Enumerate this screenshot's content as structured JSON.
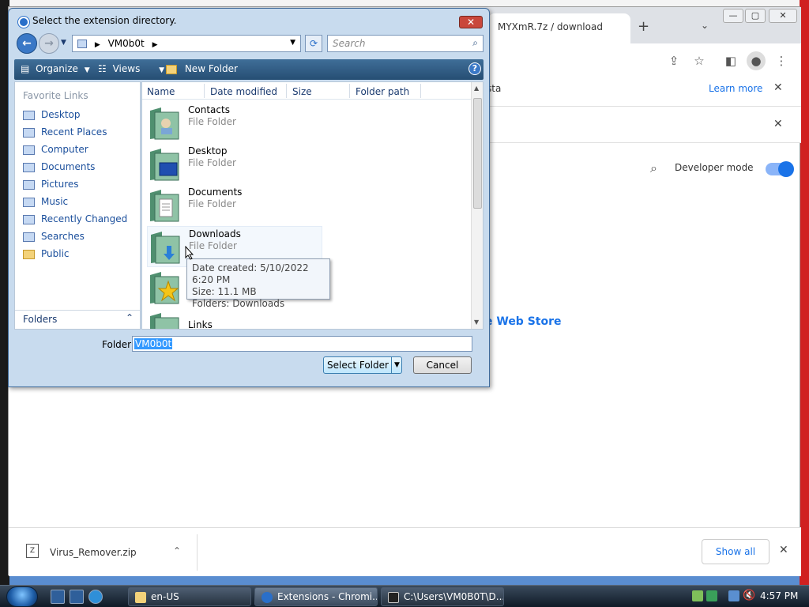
{
  "browser": {
    "tabs": [
      {
        "label": "MYXmR.7z / download"
      }
    ],
    "new_tab_label": "+",
    "banners": [
      {
        "text": "sta",
        "action": "Learn more",
        "close": "✕"
      },
      {
        "text": "",
        "close": "✕"
      }
    ],
    "developer_mode_label": "Developer mode",
    "developer_mode_on": true,
    "web_store_link": "e Web Store",
    "accent_color": "#1a73e8"
  },
  "downloads": {
    "items": [
      {
        "filename": "Virus_Remover.zip"
      }
    ],
    "show_all_label": "Show all",
    "close": "✕"
  },
  "dialog": {
    "title": "Select the extension directory.",
    "path_segment": "VM0b0t",
    "search_placeholder": "Search",
    "commands": {
      "organize": "Organize",
      "views": "Views",
      "new_folder": "New Folder",
      "help": "?"
    },
    "favorite_links_header": "Favorite Links",
    "favorite_links": [
      "Desktop",
      "Recent Places",
      "Computer",
      "Documents",
      "Pictures",
      "Music",
      "Recently Changed",
      "Searches",
      "Public"
    ],
    "folders_label": "Folders",
    "columns": [
      "Name",
      "Date modified",
      "Size",
      "Folder path"
    ],
    "files": [
      {
        "name": "Contacts",
        "type": "File Folder"
      },
      {
        "name": "Desktop",
        "type": "File Folder"
      },
      {
        "name": "Documents",
        "type": "File Folder"
      },
      {
        "name": "Downloads",
        "type": "File Folder"
      },
      {
        "name": "",
        "type": ""
      },
      {
        "name": "Links",
        "type": ""
      }
    ],
    "tooltip": {
      "date_created": "Date created: 5/10/2022 6:20 PM",
      "size": "Size: 11.1 MB",
      "folders": "Folders: Downloads"
    },
    "folder_label": "Folder:",
    "folder_value": "VM0b0t",
    "select_button": "Select Folder",
    "cancel_button": "Cancel"
  },
  "taskbar": {
    "tasks": [
      {
        "label": "en-US"
      },
      {
        "label": "Extensions - Chromi..."
      },
      {
        "label": "C:\\Users\\VM0B0T\\D..."
      }
    ],
    "clock": "4:57 PM"
  }
}
